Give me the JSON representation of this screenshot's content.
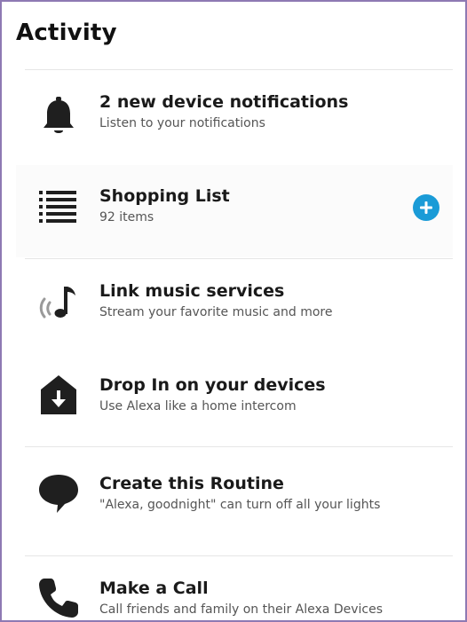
{
  "header": {
    "title": "Activity"
  },
  "items": [
    {
      "title": "2 new device notifications",
      "subtitle": "Listen to your notifications",
      "icon": "bell-icon"
    },
    {
      "title": "Shopping List",
      "subtitle": "92 items",
      "icon": "list-icon",
      "action_icon": "plus-icon"
    },
    {
      "title": "Link music services",
      "subtitle": "Stream your favorite music and more",
      "icon": "music-note-icon"
    },
    {
      "title": "Drop In on your devices",
      "subtitle": "Use Alexa like a home intercom",
      "icon": "drop-in-icon"
    },
    {
      "title": "Create this Routine",
      "subtitle": "\"Alexa, goodnight\" can turn off all your lights",
      "icon": "speech-bubble-icon"
    },
    {
      "title": "Make a Call",
      "subtitle": "Call friends and family on their Alexa Devices",
      "icon": "phone-icon"
    }
  ],
  "colors": {
    "accent": "#1a9bd7",
    "icon": "#1f1f1f",
    "frame_border": "#8e79b3"
  }
}
